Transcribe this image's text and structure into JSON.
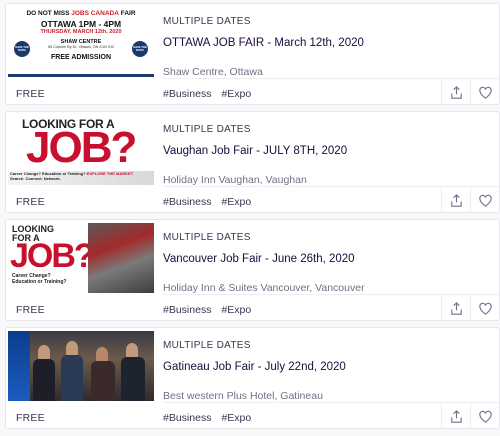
{
  "share_icon": "share-icon",
  "like_icon": "heart-icon",
  "events": [
    {
      "dates": "MULTIPLE DATES",
      "title": "OTTAWA JOB FAIR - March 12th, 2020",
      "venue": "Shaw Centre, Ottawa",
      "price": "FREE",
      "tags": [
        "#Business",
        "#Expo"
      ],
      "thumb": {
        "line1_a": "DO NOT MISS ",
        "line1_b": "JOBS CANADA",
        "line1_c": " FAIR",
        "line2": "OTTAWA 1PM - 4PM",
        "line3": "THURSDAY, MARCH 12th, 2020",
        "line4": "SHAW CENTRE",
        "line5": "55 Colonel By Dr. Ottawa, ON K1N 9J2",
        "seal_left": "SAVE THE DATE!",
        "seal_right": "SAVE THE DATE!",
        "line6": "FREE ADMISSION"
      }
    },
    {
      "dates": "MULTIPLE DATES",
      "title": "Vaughan Job Fair - JULY 8TH, 2020",
      "venue": "Holiday Inn Vaughan, Vaughan",
      "price": "FREE",
      "tags": [
        "#Business",
        "#Expo"
      ],
      "thumb": {
        "looking": "LOOKING FOR A",
        "job": "JOB?",
        "sub1": "Career Change? Education or Training? ",
        "sub1_em": "EXPLORE THE MARKET",
        "sub2": "Search. Connect. Network."
      }
    },
    {
      "dates": "MULTIPLE DATES",
      "title": "Vancouver Job Fair - June 26th, 2020",
      "venue": "Holiday Inn & Suites Vancouver, Vancouver",
      "price": "FREE",
      "tags": [
        "#Business",
        "#Expo"
      ],
      "thumb": {
        "looking": "LOOKING",
        "for_a": "FOR A",
        "job": "JOB?",
        "sub1": "Career Change?",
        "sub2": "Education or Training?"
      }
    },
    {
      "dates": "MULTIPLE DATES",
      "title": "Gatineau Job Fair - July 22nd, 2020",
      "venue": "Best western Plus Hotel, Gatineau",
      "price": "FREE",
      "tags": [
        "#Business",
        "#Expo"
      ]
    }
  ]
}
